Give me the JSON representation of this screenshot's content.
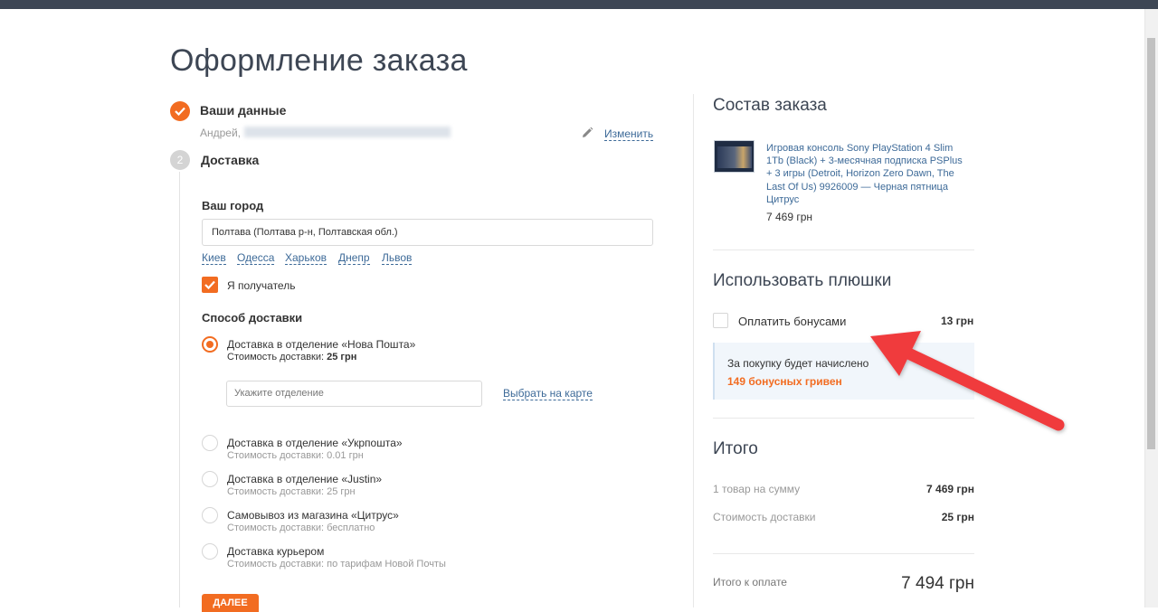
{
  "page": {
    "title": "Оформление заказа"
  },
  "steps": {
    "step1": {
      "title": "Ваши данные",
      "info_name": "Андрей,",
      "edit_label": "Изменить"
    },
    "step2": {
      "number": "2",
      "title": "Доставка"
    }
  },
  "delivery": {
    "city_label": "Ваш город",
    "city_value": "Полтава (Полтава р-н, Полтавская обл.)",
    "cities": [
      "Киев",
      "Одесса",
      "Харьков",
      "Днепр",
      "Львов"
    ],
    "recipient_label": "Я получатель",
    "recipient_checked": true,
    "method_label": "Способ доставки",
    "options": [
      {
        "title": "Доставка в отделение «Нова Пошта»",
        "cost_prefix": "Стоимость доставки:",
        "cost": "25 грн",
        "selected": true
      },
      {
        "title": "Доставка в отделение «Укрпошта»",
        "cost": "Стоимость доставки: 0.01 грн",
        "selected": false
      },
      {
        "title": "Доставка в отделение «Justin»",
        "cost": "Стоимость доставки: 25 грн",
        "selected": false
      },
      {
        "title": "Самовывоз из магазина «Цитрус»",
        "cost": "Стоимость доставки: бесплатно",
        "selected": false
      },
      {
        "title": "Доставка курьером",
        "cost": "Стоимость доставки: по тарифам Новой Почты",
        "selected": false
      }
    ],
    "branch_placeholder": "Укажите отделение",
    "map_link": "Выбрать на карте",
    "next_button": "ДАЛЕЕ"
  },
  "order": {
    "heading": "Состав заказа",
    "product_name": "Игровая консоль Sony PlayStation 4 Slim 1Tb (Black) + 3-месячная подписка PSPlus + 3 игры (Detroit, Horizon Zero Dawn, The Last Of Us) 9926009 — Черная пятница Цитрус",
    "product_price": "7 469 грн"
  },
  "bonuses": {
    "heading": "Использовать плюшки",
    "pay_label": "Оплатить бонусами",
    "pay_amount": "13 грн",
    "note": "За покупку будет начислено",
    "earn": "149 бонусных гривен"
  },
  "summary": {
    "heading": "Итого",
    "items_label": "1 товар на сумму",
    "items_value": "7 469 грн",
    "delivery_label": "Стоимость доставки",
    "delivery_value": "25 грн",
    "total_label": "Итого к оплате",
    "total_value": "7 494 грн"
  },
  "colors": {
    "accent": "#f26c21",
    "link": "#3d6a98",
    "header": "#3d4654",
    "annotation_arrow": "#f03a3e"
  },
  "annotation": {
    "icon": "red-arrow-icon"
  }
}
